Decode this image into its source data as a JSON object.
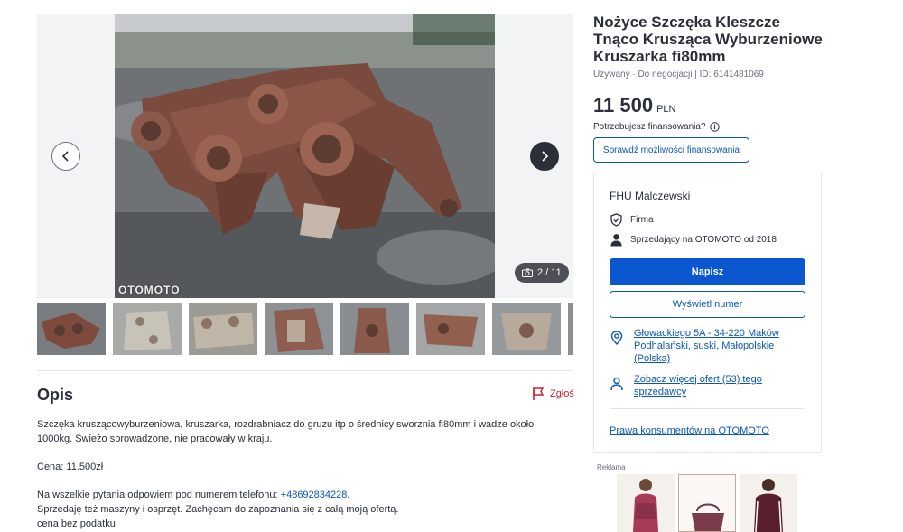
{
  "gallery": {
    "watermark": "OTOMOTO",
    "counter": "2 / 11",
    "thumbnail_count": 7
  },
  "listing": {
    "title": "Nożyce Szczęka Kleszcze Tnąco Krusząca Wyburzeniowe Kruszarka fi80mm",
    "meta": "Używany · Do negocjacji | ID: 6141481069",
    "price": "11 500",
    "currency": "PLN",
    "financing_question": "Potrzebujesz finansowania?",
    "financing_button": "Sprawdź możliwości finansowania"
  },
  "seller": {
    "name": "FHU Malczewski",
    "type": "Firma",
    "since": "Sprzedający na OTOMOTO od 2018",
    "write_button": "Napisz",
    "show_number_button": "Wyświetl numer",
    "address": "Głowackiego 5A - 34-220 Maków Podhalański, suski, Małopolskie (Polska)",
    "more_offers": "Zobacz więcej ofert (53) tego sprzedawcy",
    "consumer_rights": "Prawa konsumentów na OTOMOTO"
  },
  "description": {
    "title": "Opis",
    "report_label": "Zgłoś",
    "paragraph1": "Szczęka kruszącowyburzeniowa, kruszarka, rozdrabniacz do gruzu itp o średnicy sworznia fi80mm i wadze około 1000kg. Świeżo sprowadzone, nie pracowały w kraju.",
    "price_line": "Cena: 11.500zł",
    "contact_line": "Na wszelkie pytania odpowiem pod numerem telefonu: ",
    "phone": "+48692834228",
    "contact_end": ".",
    "offer_line": "Sprzedaję też maszyny i osprzęt. Zachęcam do zapoznania się z całą moją ofertą.",
    "net_line": "cena bez podatku"
  },
  "ad": {
    "label": "Reklama"
  },
  "colors": {
    "primary": "#0b57d0",
    "link": "#0b57b8",
    "text": "#2a2f3a",
    "report": "#c8232c"
  }
}
